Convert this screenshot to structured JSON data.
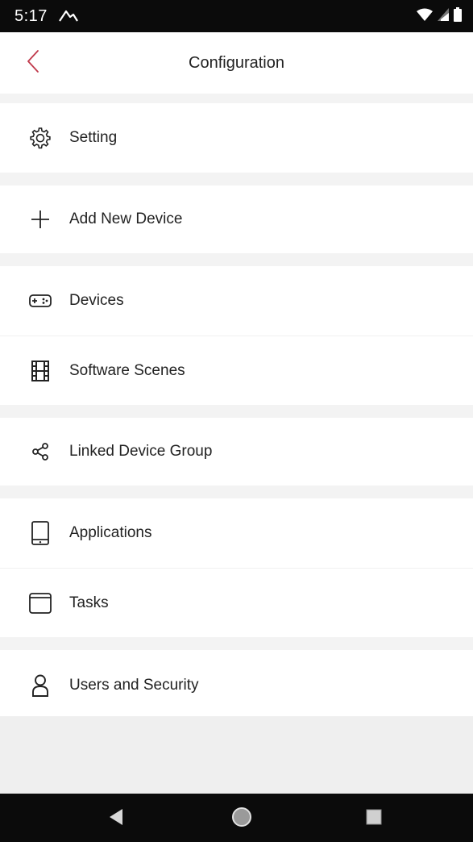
{
  "status_bar": {
    "time": "5:17",
    "notification_icon": "notification-icon",
    "wifi_icon": "wifi-icon",
    "signal_icon": "cell-signal-icon",
    "battery_icon": "battery-icon"
  },
  "header": {
    "title": "Configuration",
    "back_icon": "chevron-left-icon",
    "accent_color": "#c0394b"
  },
  "menu": {
    "items": [
      {
        "label": "Setting",
        "icon": "gear-icon"
      },
      {
        "label": "Add New Device",
        "icon": "plus-icon"
      },
      {
        "label": "Devices",
        "icon": "gamepad-icon"
      },
      {
        "label": "Software Scenes",
        "icon": "film-icon"
      },
      {
        "label": "Linked Device Group",
        "icon": "share-nodes-icon"
      },
      {
        "label": "Applications",
        "icon": "tablet-icon"
      },
      {
        "label": "Tasks",
        "icon": "cylinder-icon"
      },
      {
        "label": "Users and Security",
        "icon": "user-icon"
      }
    ]
  },
  "nav_bar": {
    "back_icon": "nav-back-icon",
    "home_icon": "nav-home-icon",
    "recents_icon": "nav-recents-icon"
  }
}
